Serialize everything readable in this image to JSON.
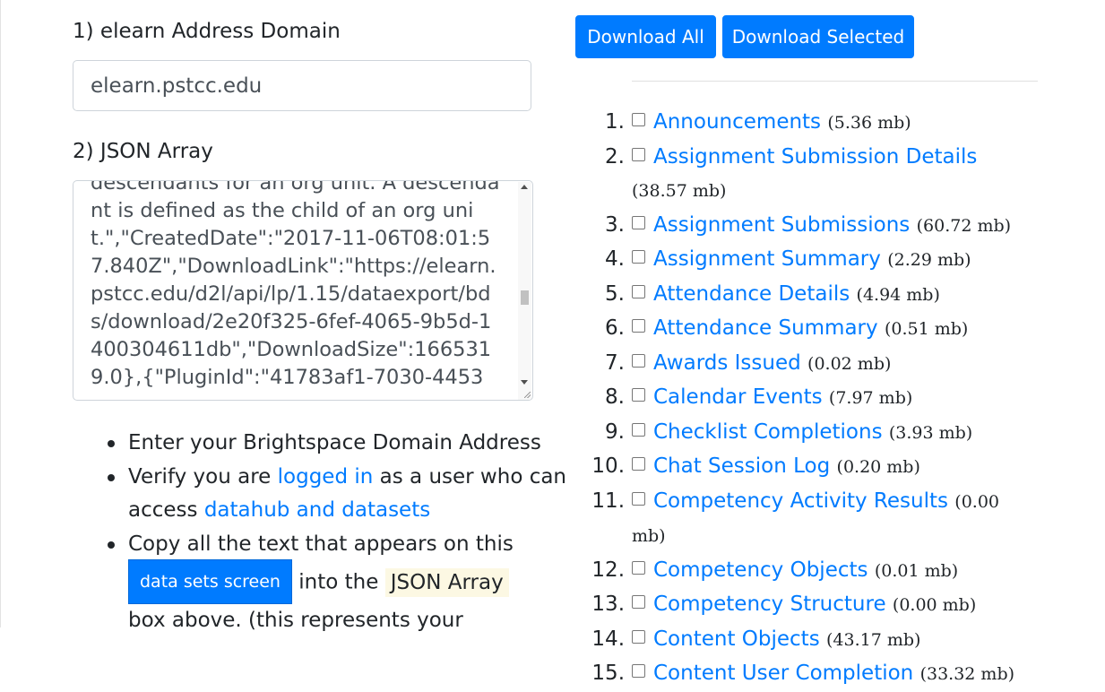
{
  "form": {
    "domain_label": "1) elearn Address Domain",
    "domain_value": "elearn.pstcc.edu",
    "json_label": "2) JSON Array",
    "json_value": "descendants for an org unit. A descendant is defined as the child of an org unit.\",\"CreatedDate\":\"2017-11-06T08:01:57.840Z\",\"DownloadLink\":\"https://elearn.pstcc.edu/d2l/api/lp/1.15/dataexport/bds/download/2e20f325-6fef-4065-9b5d-1400304611db\",\"DownloadSize\":1665319.0},{\"PluginId\":\"41783af1-7030-4453"
  },
  "instructions": {
    "item1": "Enter your Brightspace Domain Address",
    "item2_pre": "Verify you are ",
    "item2_link1": "logged in",
    "item2_mid": " as a user who can access ",
    "item2_link2": "datahub and datasets",
    "item3_pre": "Copy all the text that appears on this ",
    "item3_button": "data sets screen",
    "item3_mid": " into the ",
    "item3_mark": "JSON Array",
    "item3_post": " box above. (this represents your"
  },
  "toolbar": {
    "download_all": "Download All",
    "download_selected": "Download Selected"
  },
  "datasets": [
    {
      "num": "1.",
      "name": "Announcements",
      "size": "(5.36 mb)"
    },
    {
      "num": "2.",
      "name": "Assignment Submission Details",
      "size": "(38.57 mb)"
    },
    {
      "num": "3.",
      "name": "Assignment Submissions",
      "size": "(60.72 mb)"
    },
    {
      "num": "4.",
      "name": "Assignment Summary",
      "size": "(2.29 mb)"
    },
    {
      "num": "5.",
      "name": "Attendance Details",
      "size": "(4.94 mb)"
    },
    {
      "num": "6.",
      "name": "Attendance Summary",
      "size": "(0.51 mb)"
    },
    {
      "num": "7.",
      "name": "Awards Issued",
      "size": "(0.02 mb)"
    },
    {
      "num": "8.",
      "name": "Calendar Events",
      "size": "(7.97 mb)"
    },
    {
      "num": "9.",
      "name": "Checklist Completions",
      "size": "(3.93 mb)"
    },
    {
      "num": "10.",
      "name": "Chat Session Log",
      "size": "(0.20 mb)"
    },
    {
      "num": "11.",
      "name": "Competency Activity Results",
      "size": "(0.00 mb)"
    },
    {
      "num": "12.",
      "name": "Competency Objects",
      "size": "(0.01 mb)"
    },
    {
      "num": "13.",
      "name": "Competency Structure",
      "size": "(0.00 mb)"
    },
    {
      "num": "14.",
      "name": "Content Objects",
      "size": "(43.17 mb)"
    },
    {
      "num": "15.",
      "name": "Content User Completion",
      "size": "(33.32 mb)"
    }
  ]
}
